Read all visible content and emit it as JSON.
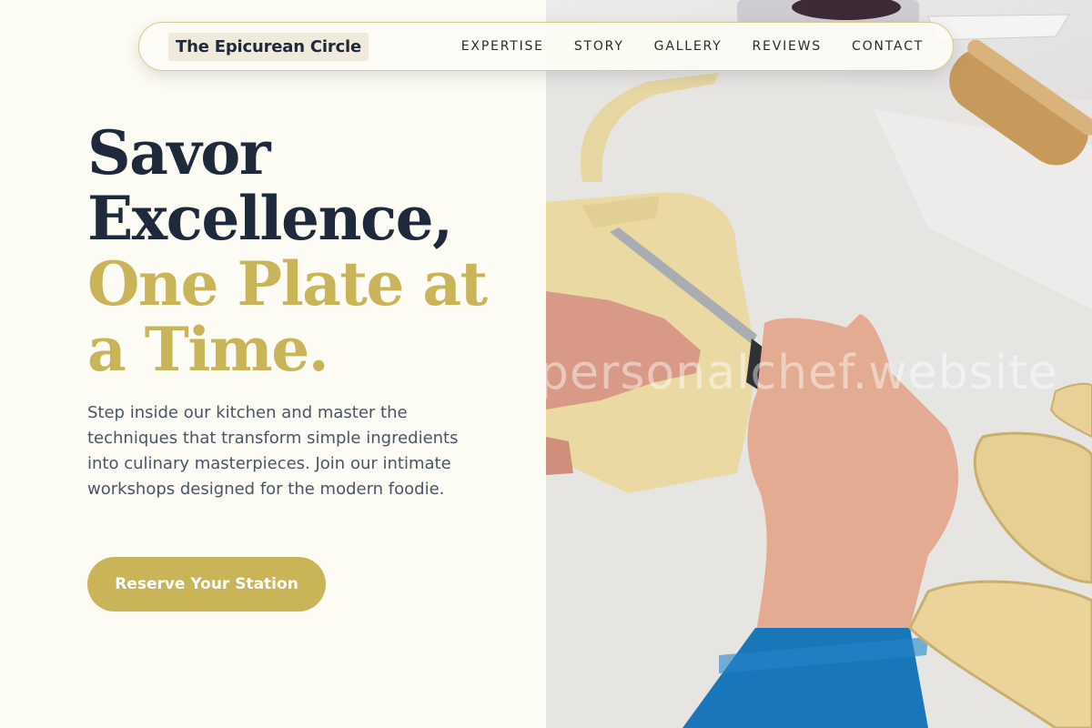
{
  "nav": {
    "brand": "The Epicurean Circle",
    "links": [
      "EXPERTISE",
      "STORY",
      "GALLERY",
      "REVIEWS",
      "CONTACT"
    ]
  },
  "hero": {
    "line1": "Savor",
    "line2": "Excellence,",
    "line3": "One Plate at",
    "line4": "a Time.",
    "intro": "Step inside our kitchen and master the techniques that transform simple ingredients into culinary masterpieces. Join our intimate workshops designed for the modern foodie.",
    "cta_label": "Reserve Your Station"
  },
  "photo": {
    "watermark": "personalchef.website"
  },
  "colors": {
    "background": "#fcfbf4",
    "navy": "#1e293b",
    "gold": "#c9b458",
    "body_text": "#4a5568"
  }
}
